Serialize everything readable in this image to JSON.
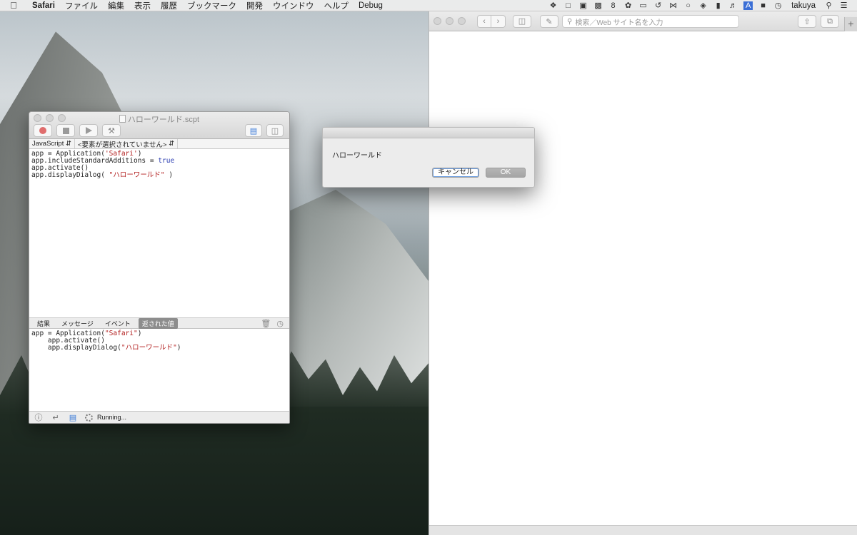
{
  "menubar": {
    "app": "Safari",
    "items": [
      "ファイル",
      "編集",
      "表示",
      "履歴",
      "ブックマーク",
      "開発",
      "ウインドウ",
      "ヘルプ",
      "Debug"
    ],
    "status_icons": [
      "dropbox-icon",
      "square-icon",
      "contacts-icon",
      "camera-icon",
      "calendar-icon",
      "paw-icon",
      "airplay-icon",
      "time-machine-icon",
      "bluetooth-icon",
      "chat-icon",
      "wifi-icon",
      "battery-icon",
      "volume-icon",
      "input-source-icon",
      "lock-icon",
      "clock-icon"
    ],
    "calendar_day": "8",
    "input_letter": "A",
    "user": "takuya"
  },
  "safari": {
    "address_placeholder": "検索／Web サイト名を入力",
    "new_tab": "+"
  },
  "editor": {
    "title": "ハローワールド.scpt",
    "language": "JavaScript",
    "element_selector": "<要素が選択されていません>",
    "script_lines": [
      {
        "pre": "app = Application(",
        "str": "'Safari'",
        "post": ")"
      },
      {
        "pre": "app.includeStandardAdditions = ",
        "kw": "true"
      },
      {
        "pre": "app.activate()"
      },
      {
        "pre": "app.displayDialog( ",
        "str": "\"ハローワールド\"",
        "post": " )"
      }
    ],
    "result_tabs": [
      "結果",
      "メッセージ",
      "イベント",
      "返された値"
    ],
    "active_tab": "返された値",
    "result_lines": [
      {
        "pre": "app = Application(",
        "str": "\"Safari\"",
        "post": ")"
      },
      {
        "pre": "    app.activate()"
      },
      {
        "pre": "    app.displayDialog(",
        "str": "\"ハローワールド\"",
        "post": ")"
      }
    ],
    "status_text": "Running..."
  },
  "dialog": {
    "message": "ハローワールド",
    "cancel_label": "キャンセル",
    "ok_label": "OK"
  }
}
